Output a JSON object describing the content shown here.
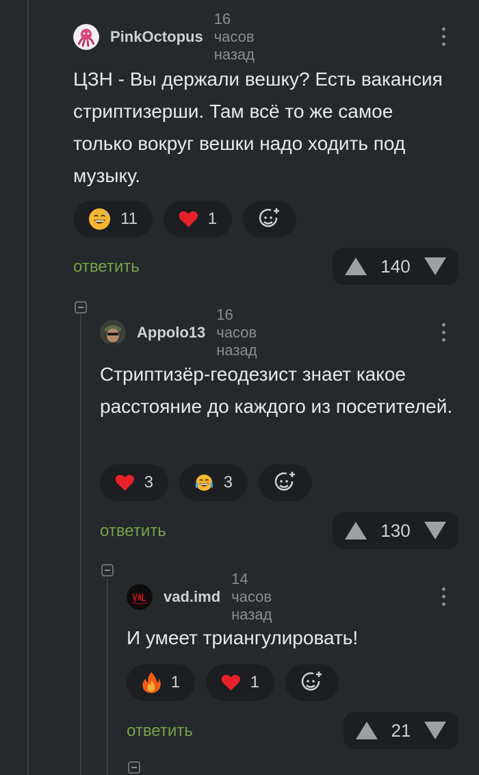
{
  "comments": [
    {
      "author": "PinkOctopus",
      "time": "16 часов назад",
      "text": "ЦЗН - Вы держали вешку? Есть вакансия стриптизерши. Там всё то же самое только вокруг вешки надо ходить под музыку.",
      "reactions": [
        {
          "icon": "grinning-sweat-emoji",
          "count": "11"
        },
        {
          "icon": "heart-emoji",
          "count": "1"
        }
      ],
      "reply_label": "ответить",
      "score": "140"
    },
    {
      "author": "Appolo13",
      "time": "16 часов назад",
      "text": "Стриптизёр-геодезист знает какое расстояние до каждого из посетителей.",
      "reactions": [
        {
          "icon": "heart-emoji",
          "count": "3"
        },
        {
          "icon": "tears-of-joy-emoji",
          "count": "3"
        }
      ],
      "reply_label": "ответить",
      "score": "130"
    },
    {
      "author": "vad.imd",
      "time": "14 часов назад",
      "text": "И умеет триангулировать!",
      "reactions": [
        {
          "icon": "fire-emoji",
          "count": "1"
        },
        {
          "icon": "heart-emoji",
          "count": "1"
        }
      ],
      "reply_label": "ответить",
      "score": "21"
    }
  ],
  "colors": {
    "background": "#26292c",
    "pill": "#1c1e21",
    "reply_link": "#74a24a",
    "heart": "#e8202a",
    "emoji_yellow": "#f7b733"
  },
  "icons": {
    "add_reaction": "add-reaction-icon",
    "upvote": "upvote-icon",
    "downvote": "downvote-icon",
    "menu": "more-vertical-icon",
    "collapse": "collapse-thread-icon"
  }
}
